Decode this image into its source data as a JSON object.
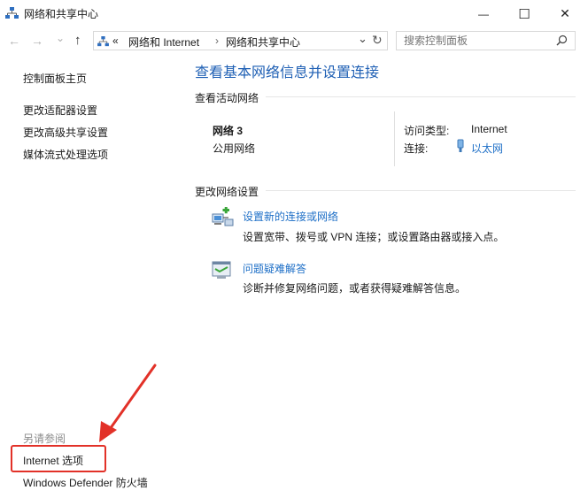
{
  "window": {
    "title": "网络和共享中心",
    "minimize_glyph": "—",
    "maximize_glyph": "☐",
    "close_glyph": "✕"
  },
  "nav": {
    "back_glyph": "←",
    "forward_glyph": "→",
    "dropdown_glyph": "⌄",
    "up_glyph": "↑",
    "breadcrumb": {
      "overflow": "«",
      "items": [
        "网络和 Internet",
        "网络和共享中心"
      ],
      "separator": "›"
    },
    "refresh_glyph": "↻",
    "search_placeholder": "搜索控制面板"
  },
  "left_pane": {
    "home_link": "控制面板主页",
    "links": [
      "更改适配器设置",
      "更改高级共享设置",
      "媒体流式处理选项"
    ],
    "see_also_title": "另请参阅",
    "see_also_links": [
      "Internet 选项",
      "Windows Defender 防火墙"
    ]
  },
  "main": {
    "heading": "查看基本网络信息并设置连接",
    "active_networks": {
      "section_title": "查看活动网络",
      "network_name": "网络 3",
      "network_type": "公用网络",
      "access_type_label": "访问类型:",
      "access_type_value": "Internet",
      "connections_label": "连接:",
      "connections_value": "以太网"
    },
    "change_settings": {
      "section_title": "更改网络设置",
      "items": [
        {
          "title": "设置新的连接或网络",
          "description": "设置宽带、拨号或 VPN 连接；或设置路由器或接入点。",
          "icon": "new-connection-icon"
        },
        {
          "title": "问题疑难解答",
          "description": "诊断并修复网络问题，或者获得疑难解答信息。",
          "icon": "troubleshoot-icon"
        }
      ]
    }
  },
  "colors": {
    "accent": "#1e5fb4",
    "link": "#1e6fc7",
    "callout": "#e23128"
  }
}
